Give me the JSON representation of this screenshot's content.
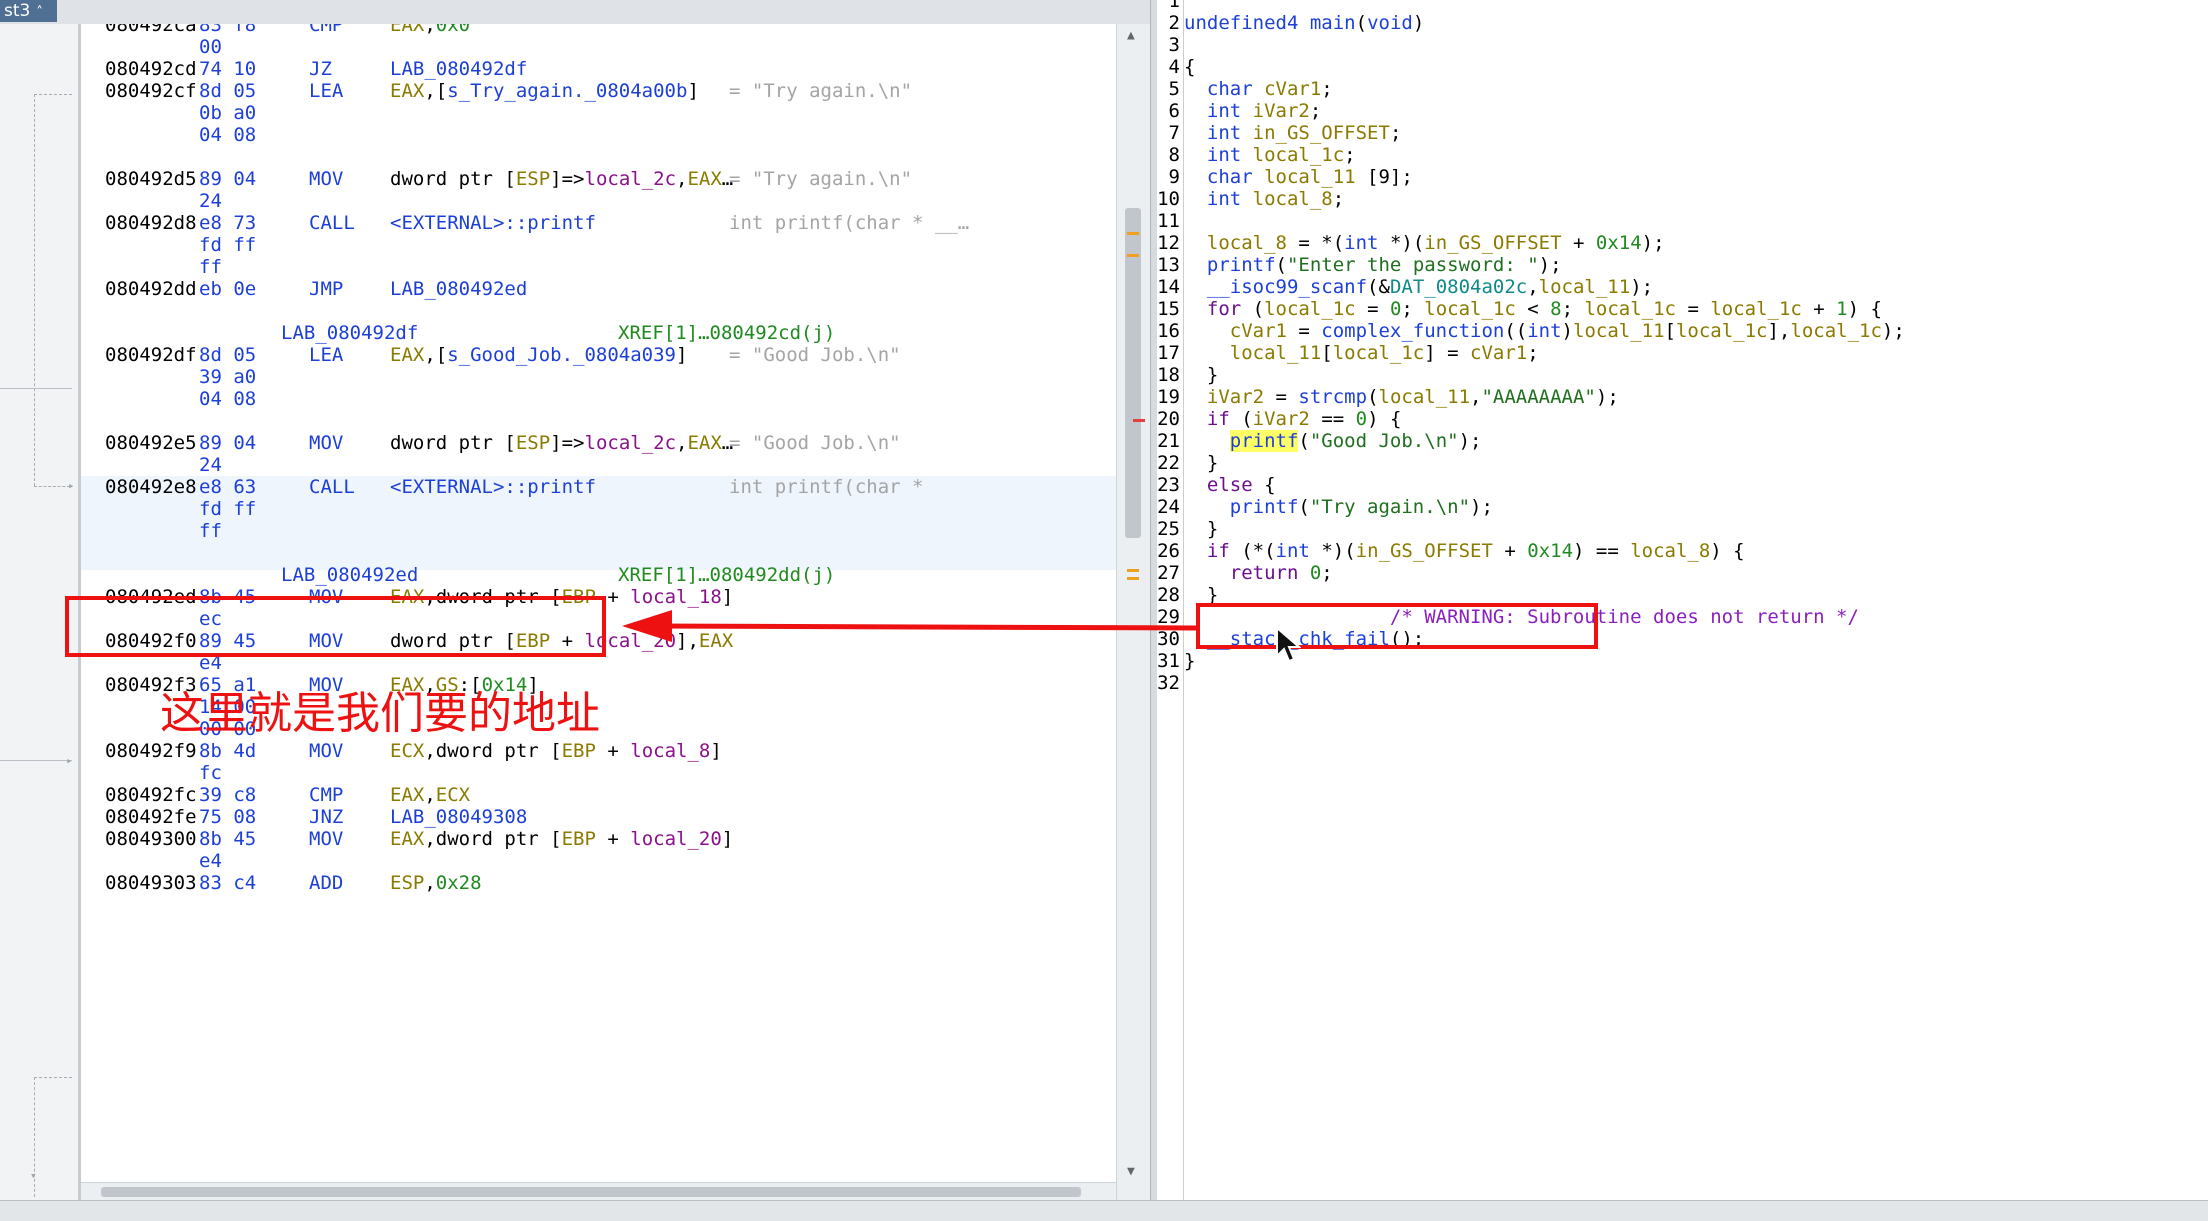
{
  "listing": {
    "tab_label": "st3",
    "tab_close": "˄",
    "rows": [
      {
        "t": "ins",
        "addr": "080492ca",
        "bytes": "83 f8",
        "mnem": "CMP",
        "ops": [
          [
            "EAX",
            "reg"
          ],
          [
            ",",
            ""
          ],
          [
            "0x0",
            "num"
          ]
        ],
        "cmt": ""
      },
      {
        "t": "cont",
        "bytes": "00"
      },
      {
        "t": "ins",
        "addr": "080492cd",
        "bytes": "74 10",
        "mnem": "JZ",
        "ops": [
          [
            "LAB_080492df",
            "lab"
          ]
        ],
        "cmt": ""
      },
      {
        "t": "ins",
        "addr": "080492cf",
        "bytes": "8d 05",
        "mnem": "LEA",
        "ops": [
          [
            "EAX",
            "reg"
          ],
          [
            ",[",
            ""
          ],
          [
            "s_Try_again._0804a00b",
            "lab"
          ],
          [
            "]",
            ""
          ]
        ],
        "cmt": "= \"Try again.\\n\""
      },
      {
        "t": "cont",
        "bytes": "0b a0"
      },
      {
        "t": "cont",
        "bytes": "04 08"
      },
      {
        "t": "blank"
      },
      {
        "t": "ins",
        "addr": "080492d5",
        "bytes": "89 04",
        "mnem": "MOV",
        "ops": [
          [
            "dword ptr [",
            ""
          ],
          [
            "ESP",
            "reg"
          ],
          [
            "]=>",
            ""
          ],
          [
            "local_2c",
            "var"
          ],
          [
            ",",
            ""
          ],
          [
            "EAX",
            "reg"
          ],
          [
            "…",
            ""
          ]
        ],
        "cmt": "= \"Try again.\\n\""
      },
      {
        "t": "cont",
        "bytes": "24"
      },
      {
        "t": "ins",
        "addr": "080492d8",
        "bytes": "e8 73",
        "mnem": "CALL",
        "ops": [
          [
            "<EXTERNAL>::printf",
            "lab"
          ]
        ],
        "cmt": "int printf(char * __…"
      },
      {
        "t": "cont",
        "bytes": "fd ff"
      },
      {
        "t": "cont",
        "bytes": "ff"
      },
      {
        "t": "ins",
        "addr": "080492dd",
        "bytes": "eb 0e",
        "mnem": "JMP",
        "ops": [
          [
            "LAB_080492ed",
            "lab"
          ]
        ],
        "cmt": ""
      },
      {
        "t": "blank"
      },
      {
        "t": "label",
        "label": "LAB_080492df",
        "xref": "XREF[1]…080492cd(j)"
      },
      {
        "t": "ins",
        "addr": "080492df",
        "bytes": "8d 05",
        "mnem": "LEA",
        "ops": [
          [
            "EAX",
            "reg"
          ],
          [
            ",[",
            ""
          ],
          [
            "s_Good_Job._0804a039",
            "lab"
          ],
          [
            "]",
            ""
          ]
        ],
        "cmt": "= \"Good Job.\\n\""
      },
      {
        "t": "cont",
        "bytes": "39 a0"
      },
      {
        "t": "cont",
        "bytes": "04 08"
      },
      {
        "t": "blank"
      },
      {
        "t": "ins",
        "addr": "080492e5",
        "bytes": "89 04",
        "mnem": "MOV",
        "ops": [
          [
            "dword ptr [",
            ""
          ],
          [
            "ESP",
            "reg"
          ],
          [
            "]=>",
            ""
          ],
          [
            "local_2c",
            "var"
          ],
          [
            ",",
            ""
          ],
          [
            "EAX",
            "reg"
          ],
          [
            "…",
            ""
          ]
        ],
        "cmt": "= \"Good Job.\\n\""
      },
      {
        "t": "cont",
        "bytes": "24"
      },
      {
        "t": "ins",
        "addr": "080492e8",
        "bytes": "e8 63",
        "mnem": "CALL",
        "ops": [
          [
            "<EXTERNAL>::printf",
            "lab"
          ]
        ],
        "cmt": "int printf(char *",
        "hl": true
      },
      {
        "t": "cont",
        "bytes": "fd ff",
        "hl": true
      },
      {
        "t": "cont",
        "bytes": "ff",
        "hl": true
      },
      {
        "t": "blank"
      },
      {
        "t": "label",
        "label": "LAB_080492ed",
        "xref": "XREF[1]…080492dd(j)"
      },
      {
        "t": "ins",
        "addr": "080492ed",
        "bytes": "8b 45",
        "mnem": "MOV",
        "ops": [
          [
            "EAX",
            "reg"
          ],
          [
            ",dword ptr [",
            ""
          ],
          [
            "EBP",
            "reg"
          ],
          [
            " + ",
            ""
          ],
          [
            "local_18",
            "var"
          ],
          [
            "]",
            ""
          ]
        ],
        "cmt": ""
      },
      {
        "t": "cont",
        "bytes": "ec"
      },
      {
        "t": "ins",
        "addr": "080492f0",
        "bytes": "89 45",
        "mnem": "MOV",
        "ops": [
          [
            "dword ptr [",
            ""
          ],
          [
            "EBP",
            "reg"
          ],
          [
            " + ",
            ""
          ],
          [
            "local_20",
            "var"
          ],
          [
            "],",
            ""
          ],
          [
            "EAX",
            "reg"
          ]
        ],
        "cmt": ""
      },
      {
        "t": "cont",
        "bytes": "e4"
      },
      {
        "t": "ins",
        "addr": "080492f3",
        "bytes": "65 a1",
        "mnem": "MOV",
        "ops": [
          [
            "EAX",
            "reg"
          ],
          [
            ",",
            ""
          ],
          [
            "GS",
            "reg"
          ],
          [
            ":[",
            ""
          ],
          [
            "0x14",
            "num"
          ],
          [
            "]",
            ""
          ]
        ],
        "cmt": ""
      },
      {
        "t": "cont",
        "bytes": "14 00"
      },
      {
        "t": "cont",
        "bytes": "00 00"
      },
      {
        "t": "ins",
        "addr": "080492f9",
        "bytes": "8b 4d",
        "mnem": "MOV",
        "ops": [
          [
            "ECX",
            "reg"
          ],
          [
            ",dword ptr [",
            ""
          ],
          [
            "EBP",
            "reg"
          ],
          [
            " + ",
            ""
          ],
          [
            "local_8",
            "var"
          ],
          [
            "]",
            ""
          ]
        ],
        "cmt": ""
      },
      {
        "t": "cont",
        "bytes": "fc"
      },
      {
        "t": "ins",
        "addr": "080492fc",
        "bytes": "39 c8",
        "mnem": "CMP",
        "ops": [
          [
            "EAX",
            "reg"
          ],
          [
            ",",
            ""
          ],
          [
            "ECX",
            "reg"
          ]
        ],
        "cmt": ""
      },
      {
        "t": "ins",
        "addr": "080492fe",
        "bytes": "75 08",
        "mnem": "JNZ",
        "ops": [
          [
            "LAB_08049308",
            "lab"
          ]
        ],
        "cmt": ""
      },
      {
        "t": "ins",
        "addr": "08049300",
        "bytes": "8b 45",
        "mnem": "MOV",
        "ops": [
          [
            "EAX",
            "reg"
          ],
          [
            ",dword ptr [",
            ""
          ],
          [
            "EBP",
            "reg"
          ],
          [
            " + ",
            ""
          ],
          [
            "local_20",
            "var"
          ],
          [
            "]",
            ""
          ]
        ],
        "cmt": ""
      },
      {
        "t": "cont",
        "bytes": "e4"
      },
      {
        "t": "ins",
        "addr": "08049303",
        "bytes": "83 c4",
        "mnem": "ADD",
        "ops": [
          [
            "ESP",
            "reg"
          ],
          [
            ",",
            ""
          ],
          [
            "0x28",
            "num"
          ]
        ],
        "cmt": ""
      }
    ]
  },
  "decompiler": {
    "lines": [
      [],
      [
        [
          "undefined4 ",
          "type"
        ],
        [
          "main",
          "fn"
        ],
        [
          "(",
          ""
        ],
        [
          "void",
          "type"
        ],
        [
          ")",
          ""
        ]
      ],
      [],
      [
        [
          "{",
          ""
        ]
      ],
      [
        [
          "  ",
          ""
        ],
        [
          "char ",
          "type"
        ],
        [
          "cVar1",
          "var"
        ],
        [
          ";",
          ""
        ]
      ],
      [
        [
          "  ",
          ""
        ],
        [
          "int ",
          "type"
        ],
        [
          "iVar2",
          "var"
        ],
        [
          ";",
          ""
        ]
      ],
      [
        [
          "  ",
          ""
        ],
        [
          "int ",
          "type"
        ],
        [
          "in_GS_OFFSET",
          "var"
        ],
        [
          ";",
          ""
        ]
      ],
      [
        [
          "  ",
          ""
        ],
        [
          "int ",
          "type"
        ],
        [
          "local_1c",
          "var"
        ],
        [
          ";",
          ""
        ]
      ],
      [
        [
          "  ",
          ""
        ],
        [
          "char ",
          "type"
        ],
        [
          "local_11",
          "var"
        ],
        [
          " [9];",
          ""
        ]
      ],
      [
        [
          "  ",
          ""
        ],
        [
          "int ",
          "type"
        ],
        [
          "local_8",
          "var"
        ],
        [
          ";",
          ""
        ]
      ],
      [],
      [
        [
          "  ",
          ""
        ],
        [
          "local_8",
          "var"
        ],
        [
          " = *(",
          ""
        ],
        [
          "int ",
          "type"
        ],
        [
          "*)(",
          ""
        ],
        [
          "in_GS_OFFSET",
          "var"
        ],
        [
          " + ",
          ""
        ],
        [
          "0x14",
          "num"
        ],
        [
          ");",
          ""
        ]
      ],
      [
        [
          "  ",
          ""
        ],
        [
          "printf",
          "fn"
        ],
        [
          "(",
          ""
        ],
        [
          "\"Enter the password: \"",
          "str"
        ],
        [
          ");",
          ""
        ]
      ],
      [
        [
          "  ",
          ""
        ],
        [
          "__isoc99_scanf",
          "fn"
        ],
        [
          "(&",
          ""
        ],
        [
          "DAT_0804a02c",
          "glob"
        ],
        [
          ",",
          ""
        ],
        [
          "local_11",
          "var"
        ],
        [
          ");",
          ""
        ]
      ],
      [
        [
          "  ",
          ""
        ],
        [
          "for ",
          "kw"
        ],
        [
          "(",
          ""
        ],
        [
          "local_1c",
          "var"
        ],
        [
          " = ",
          ""
        ],
        [
          "0",
          "num"
        ],
        [
          "; ",
          ""
        ],
        [
          "local_1c",
          "var"
        ],
        [
          " < ",
          ""
        ],
        [
          "8",
          "num"
        ],
        [
          "; ",
          ""
        ],
        [
          "local_1c",
          "var"
        ],
        [
          " = ",
          ""
        ],
        [
          "local_1c",
          "var"
        ],
        [
          " + ",
          ""
        ],
        [
          "1",
          "num"
        ],
        [
          ") {",
          ""
        ]
      ],
      [
        [
          "    ",
          ""
        ],
        [
          "cVar1",
          "var"
        ],
        [
          " = ",
          ""
        ],
        [
          "complex_function",
          "fn"
        ],
        [
          "((",
          ""
        ],
        [
          "int",
          "type"
        ],
        [
          ")",
          ""
        ],
        [
          "local_11",
          "var"
        ],
        [
          "[",
          ""
        ],
        [
          "local_1c",
          "var"
        ],
        [
          "],",
          ""
        ],
        [
          "local_1c",
          "var"
        ],
        [
          ");",
          ""
        ]
      ],
      [
        [
          "    ",
          ""
        ],
        [
          "local_11",
          "var"
        ],
        [
          "[",
          ""
        ],
        [
          "local_1c",
          "var"
        ],
        [
          "] = ",
          ""
        ],
        [
          "cVar1",
          "var"
        ],
        [
          ";",
          ""
        ]
      ],
      [
        [
          "  }",
          ""
        ]
      ],
      [
        [
          "  ",
          ""
        ],
        [
          "iVar2",
          "var"
        ],
        [
          " = ",
          ""
        ],
        [
          "strcmp",
          "fn"
        ],
        [
          "(",
          ""
        ],
        [
          "local_11",
          "var"
        ],
        [
          ",",
          ""
        ],
        [
          "\"AAAAAAAA\"",
          "str"
        ],
        [
          ");",
          ""
        ]
      ],
      [
        [
          "  ",
          ""
        ],
        [
          "if ",
          "kw"
        ],
        [
          "(",
          ""
        ],
        [
          "iVar2",
          "var"
        ],
        [
          " == ",
          ""
        ],
        [
          "0",
          "num"
        ],
        [
          ") {",
          ""
        ]
      ],
      [
        [
          "    ",
          ""
        ],
        [
          "printf",
          "fnsel"
        ],
        [
          "(",
          ""
        ],
        [
          "\"Good Job.\\n\"",
          "str"
        ],
        [
          ");",
          ""
        ]
      ],
      [
        [
          "  }",
          ""
        ]
      ],
      [
        [
          "  ",
          ""
        ],
        [
          "else ",
          "kw"
        ],
        [
          "{",
          ""
        ]
      ],
      [
        [
          "    ",
          ""
        ],
        [
          "printf",
          "fn"
        ],
        [
          "(",
          ""
        ],
        [
          "\"Try again.\\n\"",
          "str"
        ],
        [
          ");",
          ""
        ]
      ],
      [
        [
          "  }",
          ""
        ]
      ],
      [
        [
          "  ",
          ""
        ],
        [
          "if ",
          "kw"
        ],
        [
          "(*(",
          ""
        ],
        [
          "int ",
          "type"
        ],
        [
          "*)(",
          ""
        ],
        [
          "in_GS_OFFSET",
          "var"
        ],
        [
          " + ",
          ""
        ],
        [
          "0x14",
          "num"
        ],
        [
          ") == ",
          ""
        ],
        [
          "local_8",
          "var"
        ],
        [
          ") {",
          ""
        ]
      ],
      [
        [
          "    ",
          ""
        ],
        [
          "return ",
          "kw"
        ],
        [
          "0",
          "num"
        ],
        [
          ";",
          ""
        ]
      ],
      [
        [
          "  }",
          ""
        ]
      ],
      [
        [
          "                  ",
          ""
        ],
        [
          "/* WARNING: Subroutine does not return */",
          "cmt"
        ]
      ],
      [
        [
          "  ",
          ""
        ],
        [
          "__stack_chk_fail",
          "fn"
        ],
        [
          "();",
          ""
        ]
      ],
      [
        [
          "}",
          ""
        ]
      ],
      []
    ]
  },
  "annotation": {
    "text": "这里就是我们要的地址",
    "color": "#ee1111"
  },
  "colors": {
    "accent_blue": "#1c3fd8",
    "register": "#8a7a00",
    "variable": "#8b118b",
    "number": "#1f8a1f",
    "comment_gray": "#a4a4a4",
    "highlight_row": "#eef5fd",
    "selection_yellow": "#ffff66"
  },
  "icons": [
    "mouse-cursor-icon",
    "scroll-up-arrow-icon",
    "scroll-down-arrow-icon",
    "flow-arrow-icon"
  ]
}
